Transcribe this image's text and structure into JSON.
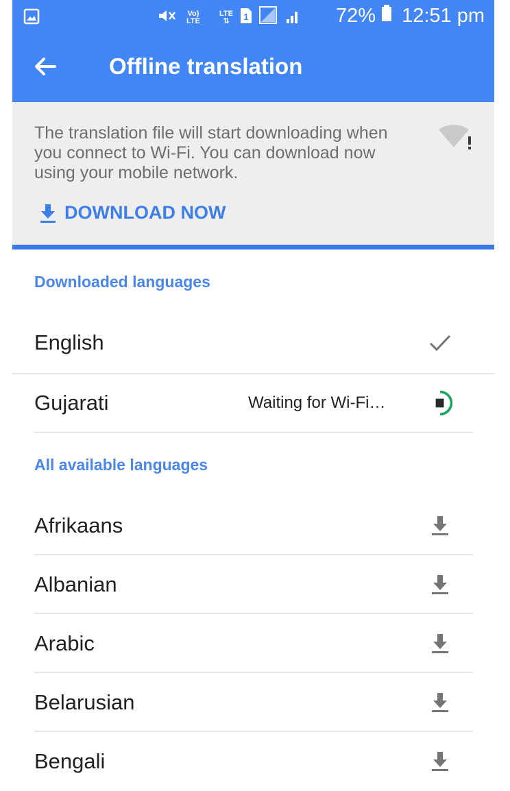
{
  "status_bar": {
    "battery_percent": "72%",
    "time": "12:51 pm",
    "network_label_top": "Vo)",
    "network_label_bottom": "LTE",
    "data_label": "LTE",
    "sim_label": "1"
  },
  "toolbar": {
    "title": "Offline translation",
    "back_icon": "arrow-back-icon"
  },
  "banner": {
    "message": "The translation file will start downloading when you connect to Wi-Fi. You can download now using your mobile network.",
    "download_now_label": "DOWNLOAD NOW",
    "icon": "wifi-warning-icon"
  },
  "downloaded_section": {
    "header": "Downloaded languages",
    "items": [
      {
        "name": "English",
        "status": "",
        "icon": "check-icon"
      },
      {
        "name": "Gujarati",
        "status": "Waiting for Wi-Fi…",
        "icon": "stop-download-progress-icon"
      }
    ]
  },
  "available_section": {
    "header": "All available languages",
    "items": [
      {
        "name": "Afrikaans",
        "icon": "download-icon"
      },
      {
        "name": "Albanian",
        "icon": "download-icon"
      },
      {
        "name": "Arabic",
        "icon": "download-icon"
      },
      {
        "name": "Belarusian",
        "icon": "download-icon"
      },
      {
        "name": "Bengali",
        "icon": "download-icon"
      }
    ]
  },
  "colors": {
    "primary": "#4285f4",
    "accent_text": "#4a86e8",
    "progress": "#1ea362"
  }
}
